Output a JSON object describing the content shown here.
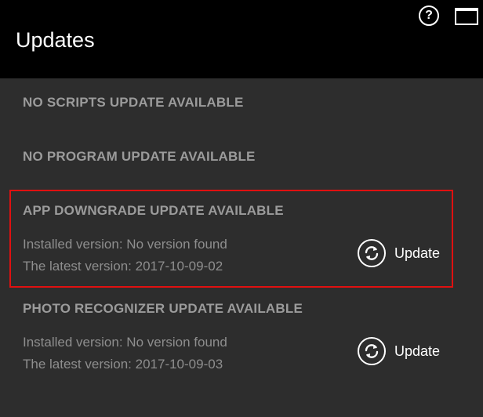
{
  "header": {
    "title": "Updates",
    "help_symbol": "?",
    "help_icon": "help-circle-icon",
    "window_icon": "window-maximize-icon"
  },
  "sections": [
    {
      "title": "NO SCRIPTS UPDATE AVAILABLE"
    },
    {
      "title": "NO PROGRAM UPDATE AVAILABLE"
    },
    {
      "title": "APP DOWNGRADE UPDATE AVAILABLE",
      "installed": "Installed version: No version found",
      "latest": "The latest version: 2017-10-09-02",
      "button_label": "Update",
      "button_icon": "refresh-icon",
      "highlighted": true
    },
    {
      "title": "PHOTO RECOGNIZER UPDATE AVAILABLE",
      "installed": "Installed version: No version found",
      "latest": "The latest version: 2017-10-09-03",
      "button_label": "Update",
      "button_icon": "refresh-icon"
    }
  ],
  "colors": {
    "header_bg": "#000000",
    "body_bg": "#2d2d2d",
    "section_title": "#9b9b9b",
    "info_text": "#8e8e8e",
    "highlight": "#e01010"
  }
}
